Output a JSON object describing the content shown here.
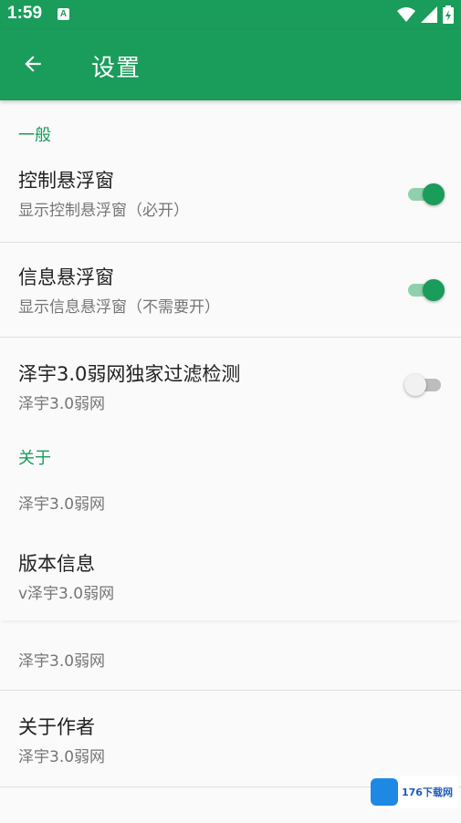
{
  "status_bar": {
    "time": "1:59",
    "app_icon_letter": "A"
  },
  "app_bar": {
    "title": "设置"
  },
  "sections": [
    {
      "header": "一般",
      "items": [
        {
          "title": "控制悬浮窗",
          "summary": "显示控制悬浮窗（必开）",
          "toggle": true
        },
        {
          "title": "信息悬浮窗",
          "summary": "显示信息悬浮窗（不需要开）",
          "toggle": true
        },
        {
          "title": "泽宇3.0弱网独家过滤检测",
          "summary": "泽宇3.0弱网",
          "toggle": false
        }
      ]
    },
    {
      "header": "关于",
      "items": [
        {
          "summary": "泽宇3.0弱网"
        },
        {
          "title": "版本信息",
          "summary": "v泽宇3.0弱网"
        },
        {
          "summary": "泽宇3.0弱网"
        },
        {
          "title": "关于作者",
          "summary": "泽宇3.0弱网"
        }
      ]
    }
  ],
  "watermark": {
    "text": "176下载网"
  },
  "colors": {
    "primary": "#1a9c5b",
    "toggle_track_on": "#8fd1ad",
    "toggle_off_track": "#bdbdbd"
  }
}
